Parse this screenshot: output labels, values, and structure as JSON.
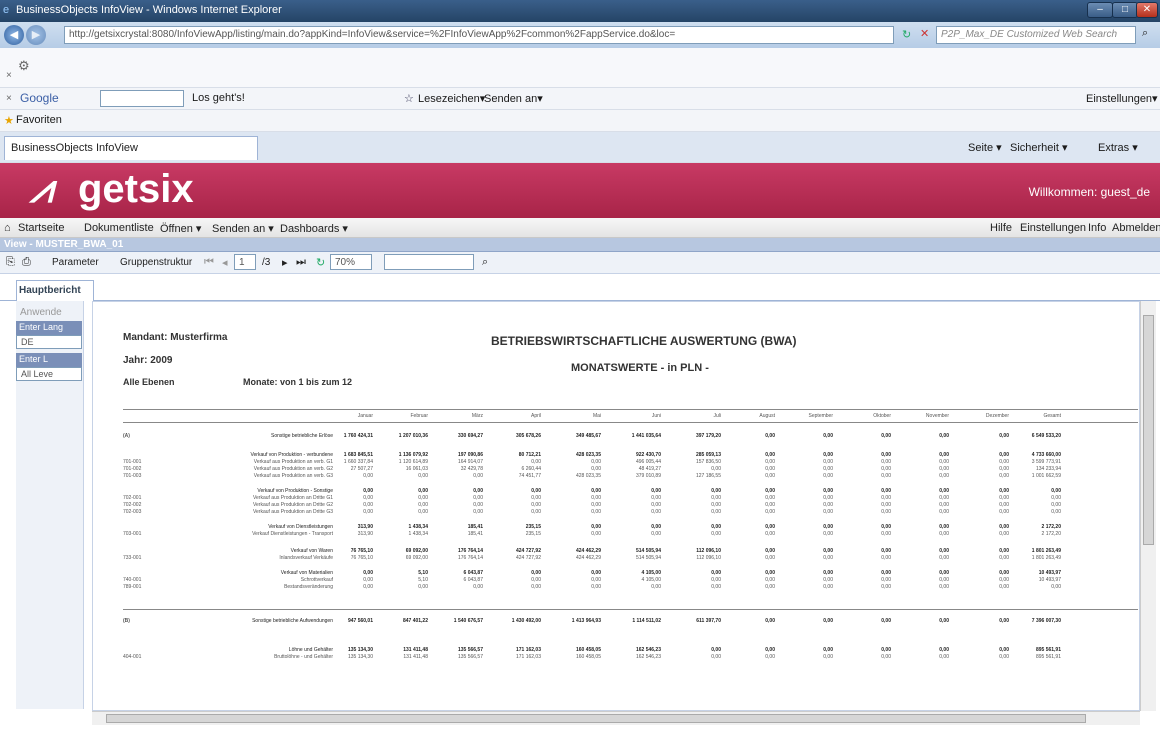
{
  "window": {
    "title": "BusinessObjects InfoView - Windows Internet Explorer"
  },
  "address": {
    "url": "http://getsixcrystal:8080/InfoViewApp/listing/main.do?appKind=InfoView&service=%2FInfoViewApp%2Fcommon%2FappService.do&loc=",
    "search_placeholder": "P2P_Max_DE Customized Web Search"
  },
  "google_bar": {
    "brand": "Google",
    "go_label": "Los geht's!",
    "bookmarks": "Lesezeichen▾",
    "send": "Senden an▾",
    "settings": "Einstellungen▾"
  },
  "favorites": {
    "label": "Favoriten"
  },
  "tab": {
    "label": "BusinessObjects InfoView"
  },
  "ie_tools": {
    "page": "Seite ▾",
    "security": "Sicherheit ▾",
    "extras": "Extras ▾"
  },
  "header": {
    "logo": "getsix",
    "welcome": "Willkommen: guest_de"
  },
  "nav": {
    "items": [
      "Startseite",
      "Dokumentliste",
      "Öffnen ▾",
      "Senden an ▾",
      "Dashboards ▾"
    ],
    "right": [
      "Hilfe",
      "Einstellungen",
      "Info",
      "Abmelden"
    ]
  },
  "view": {
    "title": "View - MUSTER_BWA_01"
  },
  "report_toolbar": {
    "param": "Parameter",
    "group": "Gruppenstruktur",
    "page": "1",
    "pages": "/3",
    "zoom": "70%"
  },
  "report_tab": "Hauptbericht",
  "left_panel": {
    "apply": "Anwende",
    "lang_label": "Enter Lang",
    "lang_value": "DE",
    "level_label": "Enter L",
    "level_value": "All Leve"
  },
  "report": {
    "mandant": "Mandant: Musterfirma",
    "jahr": "Jahr: 2009",
    "ebenen": "Alle Ebenen",
    "monate": "Monate: von 1 bis zum 12",
    "title1": "BETRIEBSWIRTSCHAFTLICHE AUSWERTUNG (BWA)",
    "title2": "MONATSWERTE - in PLN -",
    "columns": [
      "Januar",
      "Februar",
      "März",
      "April",
      "Mai",
      "Juni",
      "Juli",
      "August",
      "September",
      "Oktober",
      "November",
      "Dezember",
      "Gesamt"
    ],
    "rows": [
      {
        "code": "(A)",
        "label": "Sonstige betriebliche Erlöse",
        "bold": true,
        "values": [
          "1 760 424,31",
          "1 207 010,36",
          "330 694,27",
          "305 678,26",
          "349 485,67",
          "1 441 035,64",
          "397 179,20",
          "0,00",
          "0,00",
          "0,00",
          "0,00",
          "0,00",
          "6 549 533,20"
        ]
      },
      {
        "code": "",
        "label": "Verkauf von Produktion - verbundene",
        "bold": true,
        "values": [
          "1 683 845,51",
          "1 136 079,92",
          "197 090,86",
          "80 712,21",
          "428 023,35",
          "922 430,70",
          "285 059,13",
          "0,00",
          "0,00",
          "0,00",
          "0,00",
          "0,00",
          "4 733 660,00"
        ]
      },
      {
        "code": "701-001",
        "label": "Verkauf aus Produktion an verb. G1",
        "bold": false,
        "values": [
          "1 660 337,84",
          "1 120 614,89",
          "164 914,07",
          "0,00",
          "0,00",
          "496 005,44",
          "157 836,50",
          "0,00",
          "0,00",
          "0,00",
          "0,00",
          "0,00",
          "3 599 773,91"
        ]
      },
      {
        "code": "701-002",
        "label": "Verkauf aus Produktion an verb. G2",
        "bold": false,
        "values": [
          "27 507,27",
          "16 061,03",
          "32 429,78",
          "6 260,44",
          "0,00",
          "48 419,27",
          "0,00",
          "0,00",
          "0,00",
          "0,00",
          "0,00",
          "0,00",
          "134 233,94"
        ]
      },
      {
        "code": "701-003",
        "label": "Verkauf aus Produktion an verb. G3",
        "bold": false,
        "values": [
          "0,00",
          "0,00",
          "0,00",
          "74 451,77",
          "428 023,35",
          "379 010,89",
          "127 186,55",
          "0,00",
          "0,00",
          "0,00",
          "0,00",
          "0,00",
          "1 001 662,59"
        ]
      },
      {
        "code": "",
        "label": "Verkauf von Produktion - Sonstige",
        "bold": true,
        "values": [
          "0,00",
          "0,00",
          "0,00",
          "0,00",
          "0,00",
          "0,00",
          "0,00",
          "0,00",
          "0,00",
          "0,00",
          "0,00",
          "0,00",
          "0,00"
        ]
      },
      {
        "code": "702-001",
        "label": "Verkauf aus Produktion an Dritte G1",
        "bold": false,
        "values": [
          "0,00",
          "0,00",
          "0,00",
          "0,00",
          "0,00",
          "0,00",
          "0,00",
          "0,00",
          "0,00",
          "0,00",
          "0,00",
          "0,00",
          "0,00"
        ]
      },
      {
        "code": "702-002",
        "label": "Verkauf aus Produktion an Dritte G2",
        "bold": false,
        "values": [
          "0,00",
          "0,00",
          "0,00",
          "0,00",
          "0,00",
          "0,00",
          "0,00",
          "0,00",
          "0,00",
          "0,00",
          "0,00",
          "0,00",
          "0,00"
        ]
      },
      {
        "code": "702-003",
        "label": "Verkauf aus Produktion an Dritte G3",
        "bold": false,
        "values": [
          "0,00",
          "0,00",
          "0,00",
          "0,00",
          "0,00",
          "0,00",
          "0,00",
          "0,00",
          "0,00",
          "0,00",
          "0,00",
          "0,00",
          "0,00"
        ]
      },
      {
        "code": "",
        "label": "Verkauf von Dienstleistungen",
        "bold": true,
        "values": [
          "313,90",
          "1 438,34",
          "185,41",
          "235,15",
          "0,00",
          "0,00",
          "0,00",
          "0,00",
          "0,00",
          "0,00",
          "0,00",
          "0,00",
          "2 172,20"
        ]
      },
      {
        "code": "703-001",
        "label": "Verkauf Dienstleistungen - Transport",
        "bold": false,
        "values": [
          "313,90",
          "1 438,34",
          "185,41",
          "235,15",
          "0,00",
          "0,00",
          "0,00",
          "0,00",
          "0,00",
          "0,00",
          "0,00",
          "0,00",
          "2 172,20"
        ]
      },
      {
        "code": "",
        "label": "Verkauf von Waren",
        "bold": true,
        "values": [
          "76 765,10",
          "69 092,00",
          "176 764,14",
          "424 727,92",
          "424 462,29",
          "514 505,94",
          "112 096,10",
          "0,00",
          "0,00",
          "0,00",
          "0,00",
          "0,00",
          "1 801 263,49"
        ]
      },
      {
        "code": "733-001",
        "label": "Inlandsverkauf Verkäufe",
        "bold": false,
        "values": [
          "76 765,10",
          "69 092,00",
          "176 764,14",
          "424 727,92",
          "424 462,29",
          "514 505,94",
          "112 096,10",
          "0,00",
          "0,00",
          "0,00",
          "0,00",
          "0,00",
          "1 801 263,49"
        ]
      },
      {
        "code": "",
        "label": "Verkauf von Materialien",
        "bold": true,
        "values": [
          "0,00",
          "5,10",
          "6 043,87",
          "0,00",
          "0,00",
          "4 105,00",
          "0,00",
          "0,00",
          "0,00",
          "0,00",
          "0,00",
          "0,00",
          "10 493,97"
        ]
      },
      {
        "code": "740-001",
        "label": "Schrottverkauf",
        "bold": false,
        "values": [
          "0,00",
          "5,10",
          "6 043,87",
          "0,00",
          "0,00",
          "4 105,00",
          "0,00",
          "0,00",
          "0,00",
          "0,00",
          "0,00",
          "0,00",
          "10 493,97"
        ]
      },
      {
        "code": "789-001",
        "label": "Bestandsveränderung",
        "bold": false,
        "values": [
          "0,00",
          "0,00",
          "0,00",
          "0,00",
          "0,00",
          "0,00",
          "0,00",
          "0,00",
          "0,00",
          "0,00",
          "0,00",
          "0,00",
          "0,00"
        ]
      },
      {
        "code": "(B)",
        "label": "Sonstige betriebliche Aufwendungen",
        "bold": true,
        "values": [
          "947 560,01",
          "847 401,22",
          "1 540 676,57",
          "1 430 492,00",
          "1 413 964,93",
          "1 114 511,02",
          "611 397,70",
          "0,00",
          "0,00",
          "0,00",
          "0,00",
          "0,00",
          "7 396 007,30"
        ]
      },
      {
        "code": "",
        "label": "Löhne und Gehälter",
        "bold": true,
        "values": [
          "135 134,30",
          "131 411,48",
          "135 566,57",
          "171 162,03",
          "160 458,05",
          "162 546,23",
          "0,00",
          "0,00",
          "0,00",
          "0,00",
          "0,00",
          "0,00",
          "895 561,91"
        ]
      },
      {
        "code": "404-001",
        "label": "Bruttolöhne - und Gehälter",
        "bold": false,
        "values": [
          "135 134,30",
          "131 411,48",
          "135 566,57",
          "171 162,03",
          "160 458,05",
          "162 546,23",
          "0,00",
          "0,00",
          "0,00",
          "0,00",
          "0,00",
          "0,00",
          "895 561,91"
        ]
      }
    ]
  }
}
